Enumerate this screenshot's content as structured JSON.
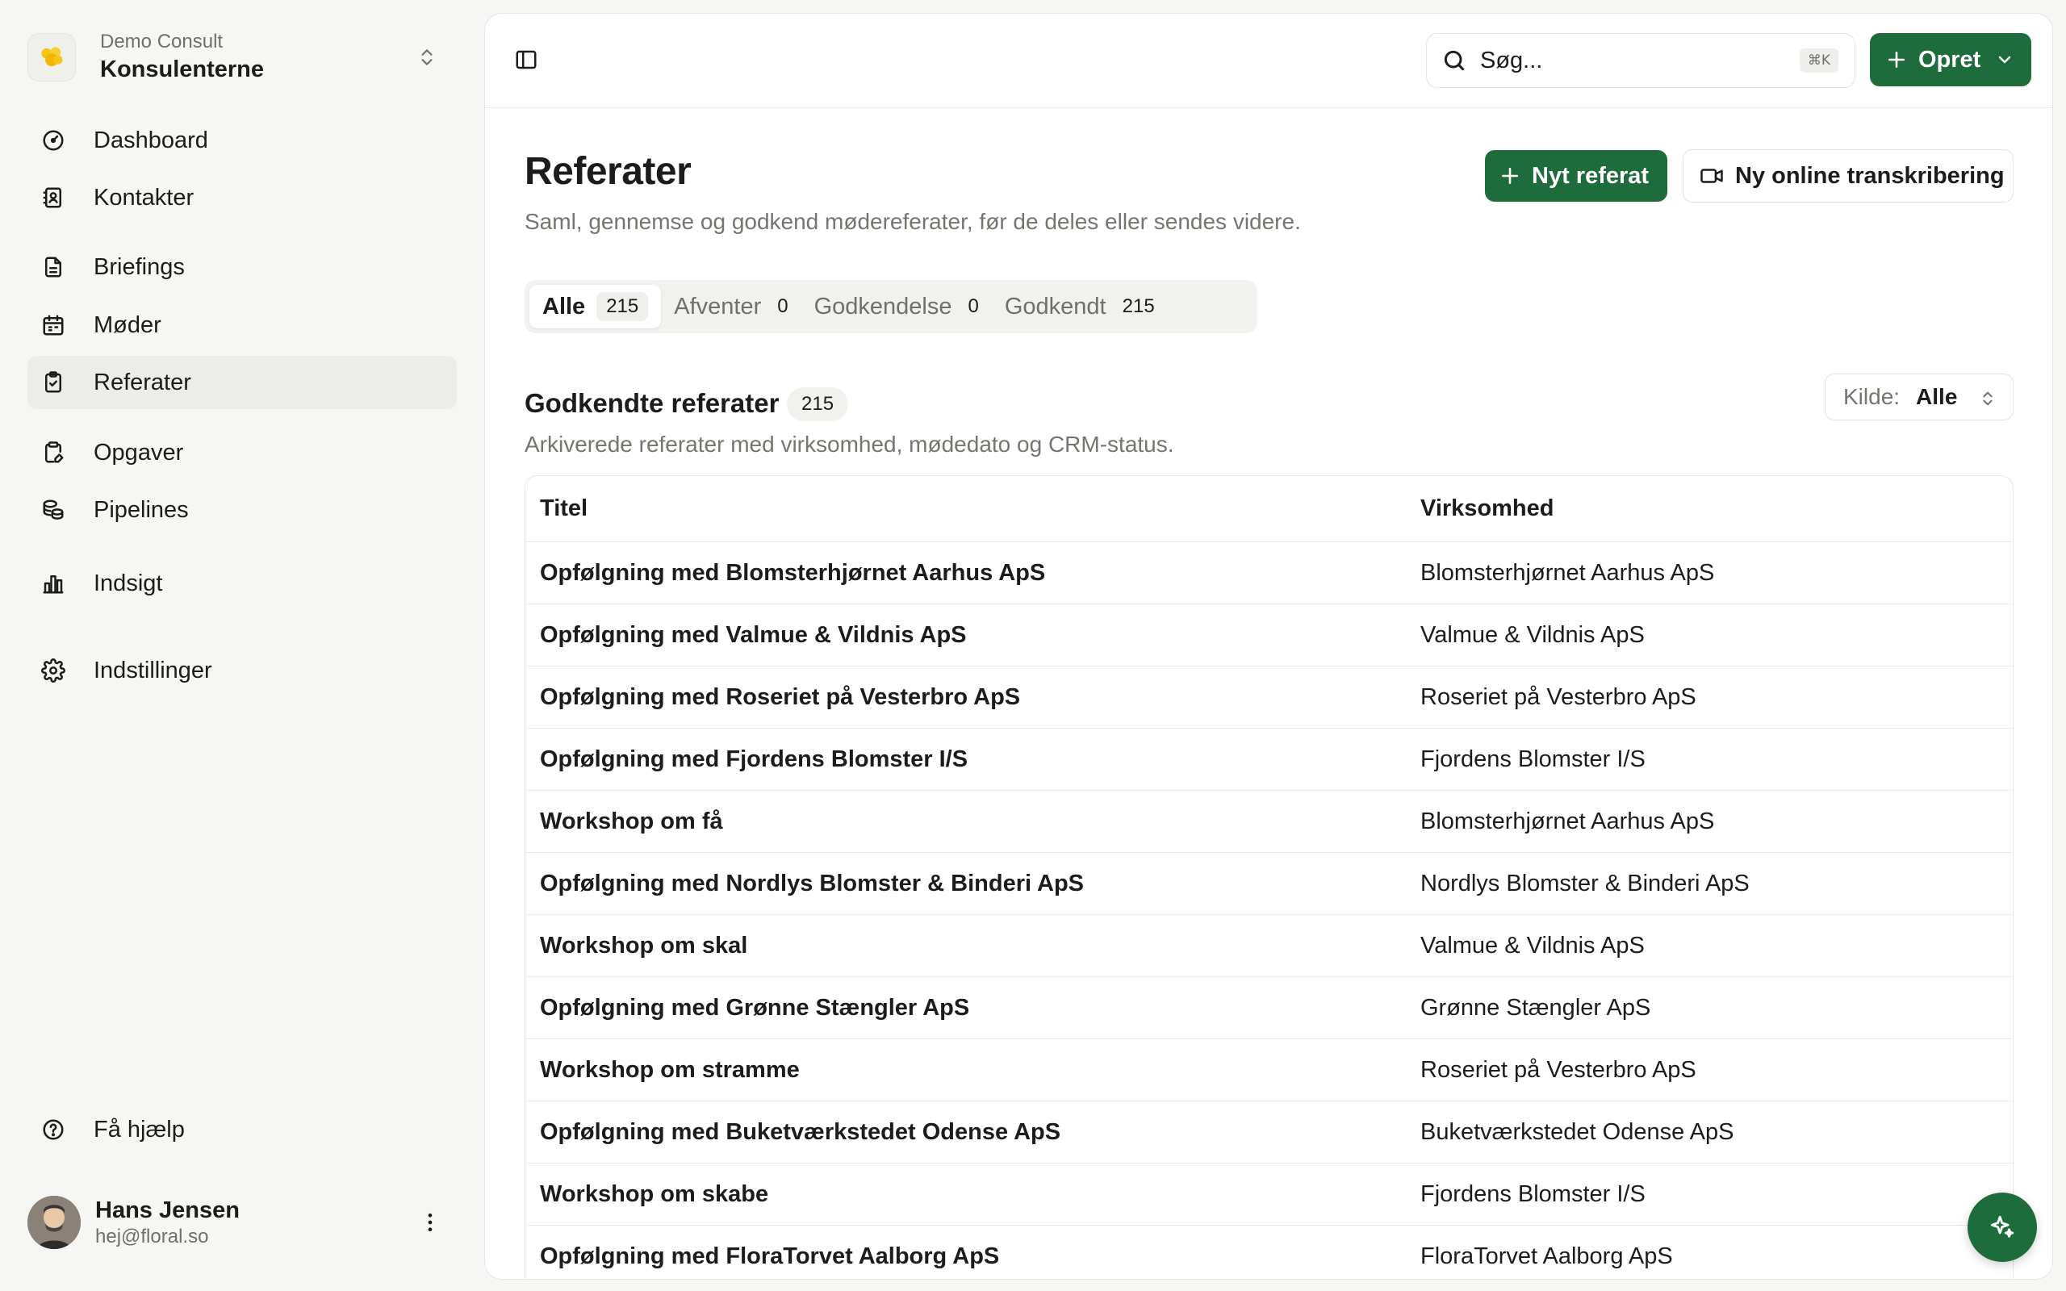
{
  "workspace": {
    "org": "Demo Consult",
    "name": "Konsulenterne"
  },
  "nav": {
    "dashboard": "Dashboard",
    "contacts": "Kontakter",
    "briefings": "Briefings",
    "meetings": "Møder",
    "minutes": "Referater",
    "tasks": "Opgaver",
    "pipelines": "Pipelines",
    "insight": "Indsigt",
    "settings": "Indstillinger",
    "help": "Få hjælp",
    "active": "Referater"
  },
  "user": {
    "name": "Hans Jensen",
    "email": "hej@floral.so"
  },
  "topbar": {
    "search_placeholder": "Søg...",
    "shortcut": "⌘K",
    "create_label": "Opret"
  },
  "page": {
    "title": "Referater",
    "subtitle": "Saml, gennemse og godkend mødereferater, før de deles eller sendes videre.",
    "new_minutes": "Nyt referat",
    "new_transcription": "Ny online transkribering"
  },
  "tabs": [
    {
      "label": "Alle",
      "count": "215",
      "active": true
    },
    {
      "label": "Afventer",
      "count": "0",
      "active": false
    },
    {
      "label": "Godkendelse",
      "count": "0",
      "active": false
    },
    {
      "label": "Godkendt",
      "count": "215",
      "active": false
    }
  ],
  "section": {
    "title": "Godkendte referater",
    "count": "215",
    "subtitle": "Arkiverede referater med virksomhed, mødedato og CRM-status.",
    "source_label": "Kilde:",
    "source_value": "Alle"
  },
  "table": {
    "columns": [
      "Titel",
      "Virksomhed"
    ],
    "rows": [
      [
        "Opfølgning med Blomsterhjørnet Aarhus ApS",
        "Blomsterhjørnet Aarhus ApS"
      ],
      [
        "Opfølgning med Valmue & Vildnis ApS",
        "Valmue & Vildnis ApS"
      ],
      [
        "Opfølgning med Roseriet på Vesterbro ApS",
        "Roseriet på Vesterbro ApS"
      ],
      [
        "Opfølgning med Fjordens Blomster I/S",
        "Fjordens Blomster I/S"
      ],
      [
        "Workshop om få",
        "Blomsterhjørnet Aarhus ApS"
      ],
      [
        "Opfølgning med Nordlys Blomster & Binderi ApS",
        "Nordlys Blomster & Binderi ApS"
      ],
      [
        "Workshop om skal",
        "Valmue & Vildnis ApS"
      ],
      [
        "Opfølgning med Grønne Stængler ApS",
        "Grønne Stængler ApS"
      ],
      [
        "Workshop om stramme",
        "Roseriet på Vesterbro ApS"
      ],
      [
        "Opfølgning med Buketværkstedet Odense ApS",
        "Buketværkstedet Odense ApS"
      ],
      [
        "Workshop om skabe",
        "Fjordens Blomster I/S"
      ],
      [
        "Opfølgning med FloraTorvet Aalborg ApS",
        "FloraTorvet Aalborg ApS"
      ]
    ]
  },
  "colors": {
    "accent": "#1e6b3c",
    "background": "#f6f6f4",
    "active_nav": "#ececea"
  },
  "icons": {
    "workspace": "flower-logo-icon",
    "dashboard": "gauge-icon",
    "contacts": "contact-book-icon",
    "briefings": "document-icon",
    "meetings": "calendar-icon",
    "minutes": "clipboard-check-icon",
    "tasks": "clipboard-pen-icon",
    "pipelines": "coins-icon",
    "insight": "bar-chart-icon",
    "settings": "gear-icon",
    "help": "help-circle-icon",
    "fab": "sparkles-icon"
  }
}
